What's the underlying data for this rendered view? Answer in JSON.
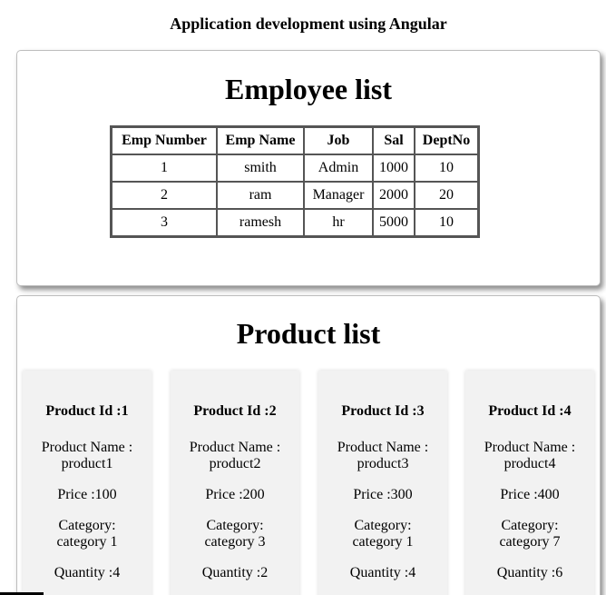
{
  "app": {
    "title": "Application development using Angular"
  },
  "employee_section": {
    "title": "Employee list",
    "columns": [
      "Emp Number",
      "Emp Name",
      "Job",
      "Sal",
      "DeptNo"
    ],
    "rows": [
      [
        "1",
        "smith",
        "Admin",
        "1000",
        "10"
      ],
      [
        "2",
        "ram",
        "Manager",
        "2000",
        "20"
      ],
      [
        "3",
        "ramesh",
        "hr",
        "5000",
        "10"
      ]
    ]
  },
  "product_section": {
    "title": "Product list",
    "products": [
      {
        "id": "Product Id :1",
        "name_label": "Product Name :",
        "name": "product1",
        "price": "Price :100",
        "category_label": "Category:",
        "category": "category 1",
        "quantity": "Quantity :4"
      },
      {
        "id": "Product Id :2",
        "name_label": "Product Name :",
        "name": "product2",
        "price": "Price :200",
        "category_label": "Category:",
        "category": "category 3",
        "quantity": "Quantity :2"
      },
      {
        "id": "Product Id :3",
        "name_label": "Product Name :",
        "name": "product3",
        "price": "Price :300",
        "category_label": "Category:",
        "category": "category 1",
        "quantity": "Quantity :4"
      },
      {
        "id": "Product Id :4",
        "name_label": "Product Name :",
        "name": "product4",
        "price": "Price :400",
        "category_label": "Category:",
        "category": "category 7",
        "quantity": "Quantity :6"
      }
    ]
  }
}
